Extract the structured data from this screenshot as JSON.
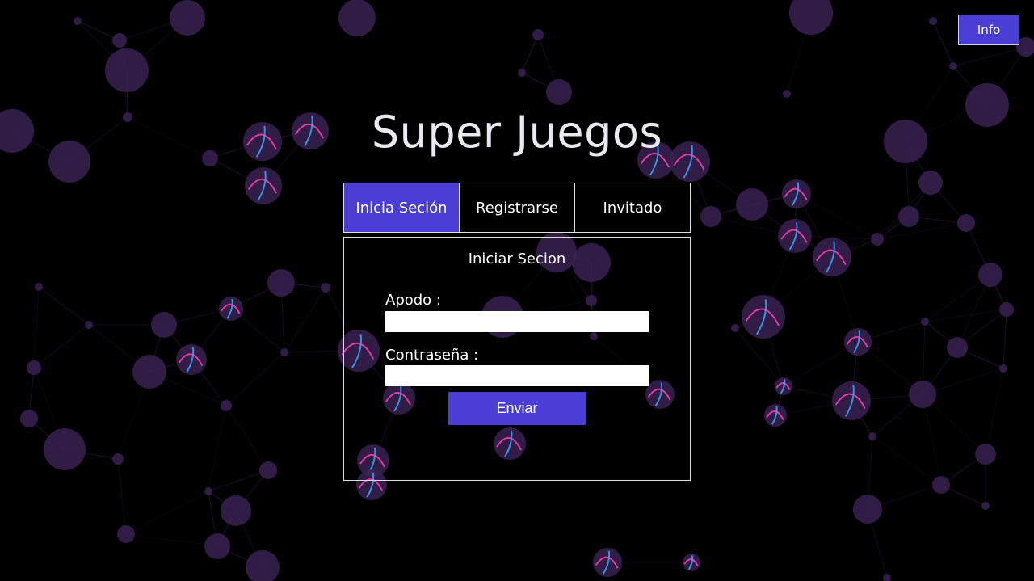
{
  "header": {
    "info_label": "Info"
  },
  "title": "Super Juegos",
  "tabs": [
    {
      "label": "Inicia Seción",
      "active": true
    },
    {
      "label": "Registrarse",
      "active": false
    },
    {
      "label": "Invitado",
      "active": false
    }
  ],
  "form": {
    "heading": "Iniciar Secion",
    "nickname_label": "Apodo :",
    "nickname_value": "",
    "password_label": "Contraseña :",
    "password_value": "",
    "submit_label": "Enviar"
  },
  "colors": {
    "accent": "#4a3ed6",
    "background": "#000000",
    "node": "#3a2152",
    "highlight_pink": "#ff3fb0",
    "highlight_cyan": "#36a8ff"
  }
}
